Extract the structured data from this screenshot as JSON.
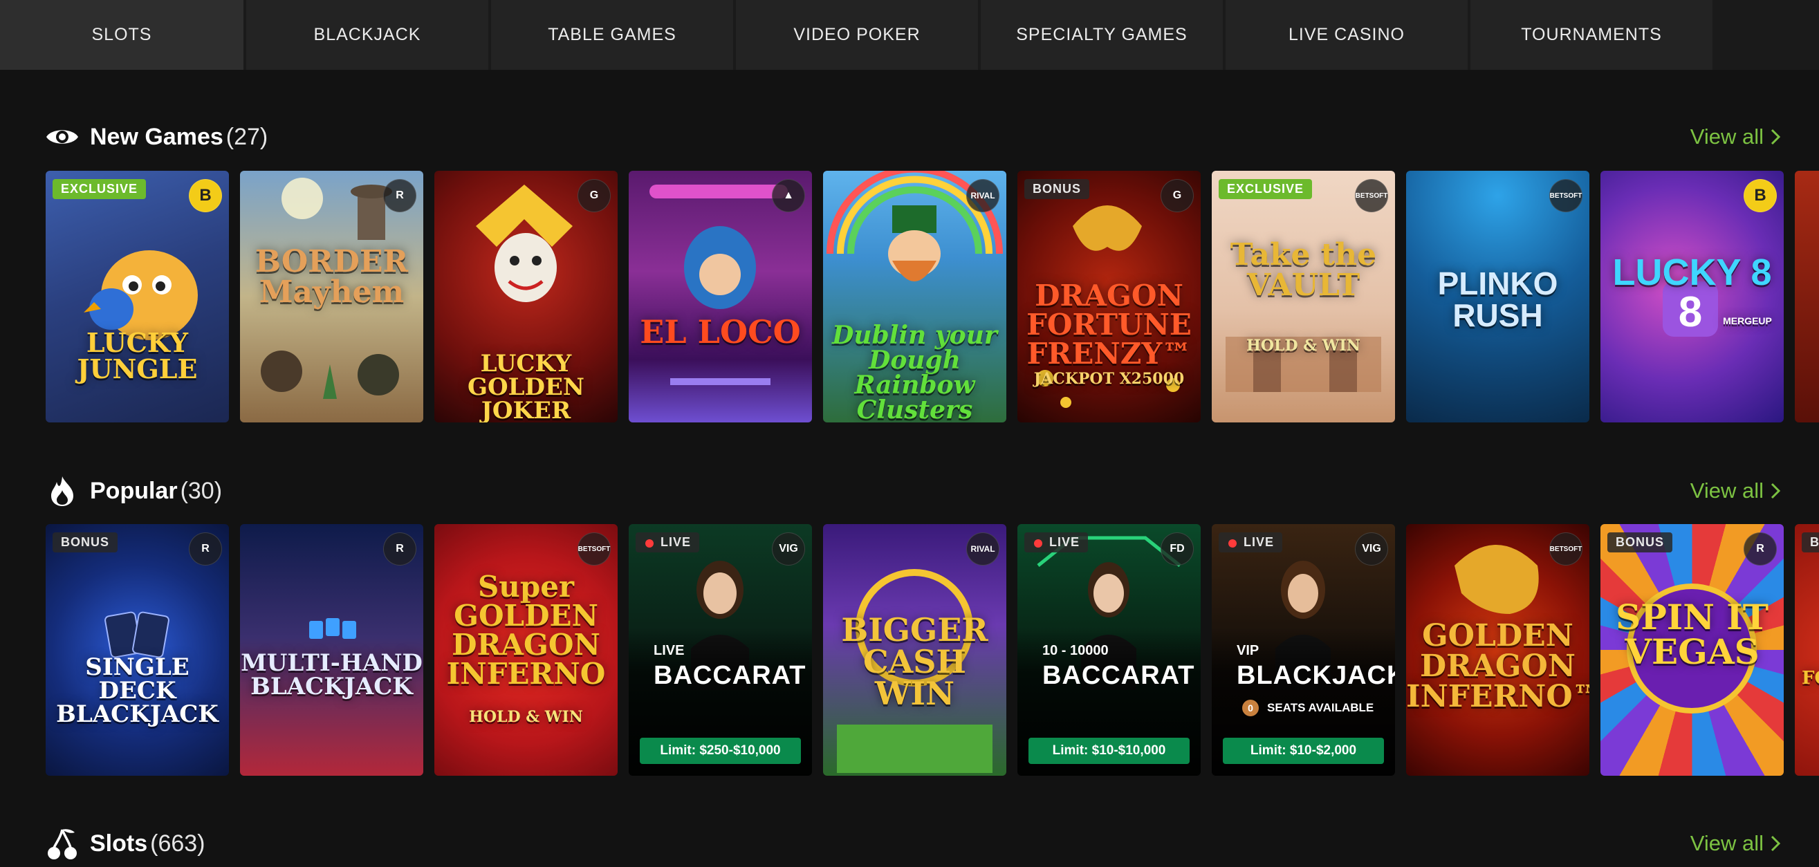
{
  "tabs": [
    {
      "label": "SLOTS",
      "active": true
    },
    {
      "label": "BLACKJACK"
    },
    {
      "label": "TABLE GAMES"
    },
    {
      "label": "VIDEO POKER"
    },
    {
      "label": "SPECIALTY GAMES"
    },
    {
      "label": "LIVE CASINO"
    },
    {
      "label": "TOURNAMENTS"
    }
  ],
  "sections": {
    "new_games": {
      "title": "New Games",
      "count": "(27)",
      "view_all": "View all",
      "icon": "eye-icon"
    },
    "popular": {
      "title": "Popular",
      "count": "(30)",
      "view_all": "View all",
      "icon": "flame-icon"
    },
    "slots": {
      "title": "Slots",
      "count": "(663)",
      "view_all": "View all",
      "icon": "cherries-icon"
    }
  },
  "new_games": [
    {
      "badge": "EXCLUSIVE",
      "provider": "B",
      "title": "LUCKY JUNGLE"
    },
    {
      "provider": "R",
      "title": "BORDER Mayhem"
    },
    {
      "provider": "G",
      "title": "LUCKY GOLDEN JOKER"
    },
    {
      "provider": "▲",
      "title": "EL LOCO"
    },
    {
      "provider": "RIVAL",
      "title": "Dublin your Dough Rainbow Clusters"
    },
    {
      "badge": "BONUS",
      "provider": "G",
      "title": "DRAGON FORTUNE FRENZY™",
      "subtitle": "JACKPOT X25000"
    },
    {
      "badge": "EXCLUSIVE",
      "provider": "BETSOFT",
      "title": "Take the VAULT",
      "subtitle": "HOLD & WIN"
    },
    {
      "provider": "BETSOFT",
      "title": "PLINKO RUSH"
    },
    {
      "provider": "B",
      "title": "LUCKY 8",
      "subtitle": "MERGEUP"
    },
    {
      "provider": "",
      "title": ""
    }
  ],
  "popular": [
    {
      "badge": "BONUS",
      "provider": "R",
      "title": "SINGLE DECK BLACKJACK"
    },
    {
      "provider": "R",
      "title": "MULTI-HAND BLACKJACK"
    },
    {
      "provider": "BETSOFT",
      "title": "Super GOLDEN DRAGON INFERNO",
      "subtitle": "HOLD & WIN"
    },
    {
      "badge": "LIVE",
      "provider": "VIG",
      "table_small": "LIVE",
      "table_big": "BACCARAT",
      "limit": "Limit: $250-$10,000"
    },
    {
      "provider": "RIVAL",
      "title": "BIGGER CASH WIN"
    },
    {
      "badge": "LIVE",
      "provider": "FD",
      "table_small": "10 - 10000",
      "table_big": "BACCARAT",
      "limit": "Limit: $10-$10,000"
    },
    {
      "badge": "LIVE",
      "provider": "VIG",
      "table_small": "VIP",
      "table_big": "BLACKJACK",
      "seats_count": "0",
      "seats_label": "SEATS AVAILABLE",
      "limit": "Limit: $10-$2,000"
    },
    {
      "provider": "BETSOFT",
      "title": "GOLDEN DRAGON INFERNO™"
    },
    {
      "badge": "BONUS",
      "provider": "R",
      "title": "SPIN IT VEGAS"
    },
    {
      "badge": "BO",
      "provider": "",
      "title": "FO"
    }
  ],
  "colors": {
    "accent_green": "#7cc242",
    "badge_green": "#6cba2c",
    "limit_green": "#0a8a4c",
    "live_dot": "#ff3b3b"
  }
}
